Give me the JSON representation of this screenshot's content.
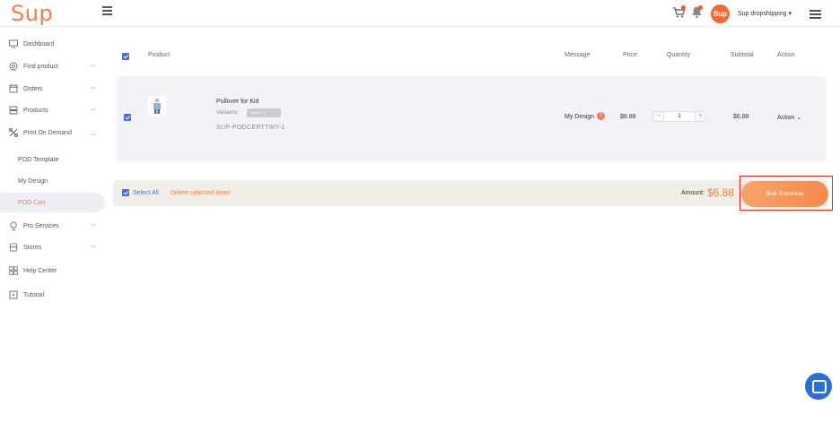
{
  "header": {
    "logo": "Sup",
    "avatar_text": "Sup",
    "account_name": "Sup dropshipping",
    "account_caret": "▾"
  },
  "sidebar": {
    "items": [
      {
        "label": "Dashboard",
        "icon": "monitor-icon"
      },
      {
        "label": "Find product",
        "icon": "search-icon",
        "chevron": "﹀"
      },
      {
        "label": "Orders",
        "icon": "orders-icon",
        "chevron": "﹀"
      },
      {
        "label": "Products",
        "icon": "products-icon",
        "chevron": "﹀"
      },
      {
        "label": "Print On Demand",
        "icon": "pod-icon",
        "chevron": "︿"
      },
      {
        "label": "Pro Services",
        "icon": "services-icon",
        "chevron": "﹀"
      },
      {
        "label": "Stores",
        "icon": "store-icon",
        "chevron": "﹀"
      },
      {
        "label": "Help Center",
        "icon": "help-icon"
      },
      {
        "label": "Tutorial",
        "icon": "tutorial-icon"
      }
    ],
    "pod_children": [
      "POD Template",
      "My Design",
      "POD Cart"
    ]
  },
  "table": {
    "headers": {
      "product": "Product",
      "message": "Message",
      "price": "Price",
      "quantity": "Quantity",
      "subtotal": "Subtotal",
      "action": "Action"
    },
    "row": {
      "name": "Pullover for Kid",
      "variants_label": "Variants:",
      "variant_tag": "White / 2",
      "sku": "SUP-PODCERTTWY-1",
      "message": "My Design",
      "message_badge": "2",
      "price": "$6.88",
      "qty_minus": "−",
      "qty_value": "1",
      "qty_plus": "+",
      "subtotal": "$6.88",
      "action": "Action",
      "action_caret": "⌄"
    }
  },
  "footer": {
    "select_all": "Select All",
    "delete_selected": "Delete selected items",
    "amount_label": "Amount:",
    "amount_value": "$6.88",
    "bulk_purchase": "Bulk Purchase"
  },
  "colors": {
    "accent": "#f47c4c",
    "checkbox": "#4a6fd6",
    "highlight_box": "#e0231b",
    "chat": "#2a6fd8"
  }
}
